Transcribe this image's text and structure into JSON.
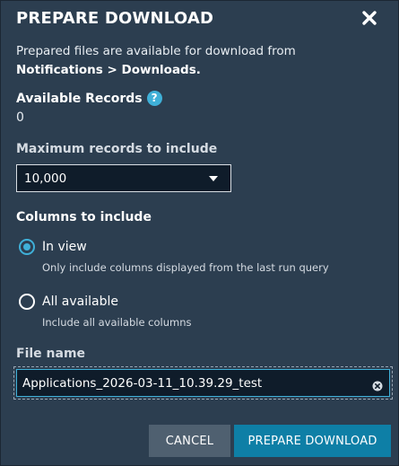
{
  "dialog": {
    "title": "PREPARE DOWNLOAD",
    "close_icon": "close-icon",
    "intro_text": "Prepared files are available for download from",
    "intro_path": "Notifications > Downloads."
  },
  "available_records": {
    "label": "Available Records",
    "help_icon": "?",
    "value": "0"
  },
  "max_records": {
    "label": "Maximum records to include",
    "selected": "10,000"
  },
  "columns": {
    "label": "Columns to include",
    "options": [
      {
        "label": "In view",
        "description": "Only include columns displayed from the last run query",
        "selected": true
      },
      {
        "label": "All available",
        "description": "Include all available columns",
        "selected": false
      }
    ]
  },
  "file_name": {
    "label": "File name",
    "value": "Applications_2026-03-11_10.39.29_test"
  },
  "buttons": {
    "cancel": "CANCEL",
    "prepare": "PREPARE DOWNLOAD"
  },
  "colors": {
    "background": "#2c3e50",
    "accent": "#3fb0d8",
    "primary_button": "#0e7fa6",
    "cancel_button": "#4f6070"
  }
}
